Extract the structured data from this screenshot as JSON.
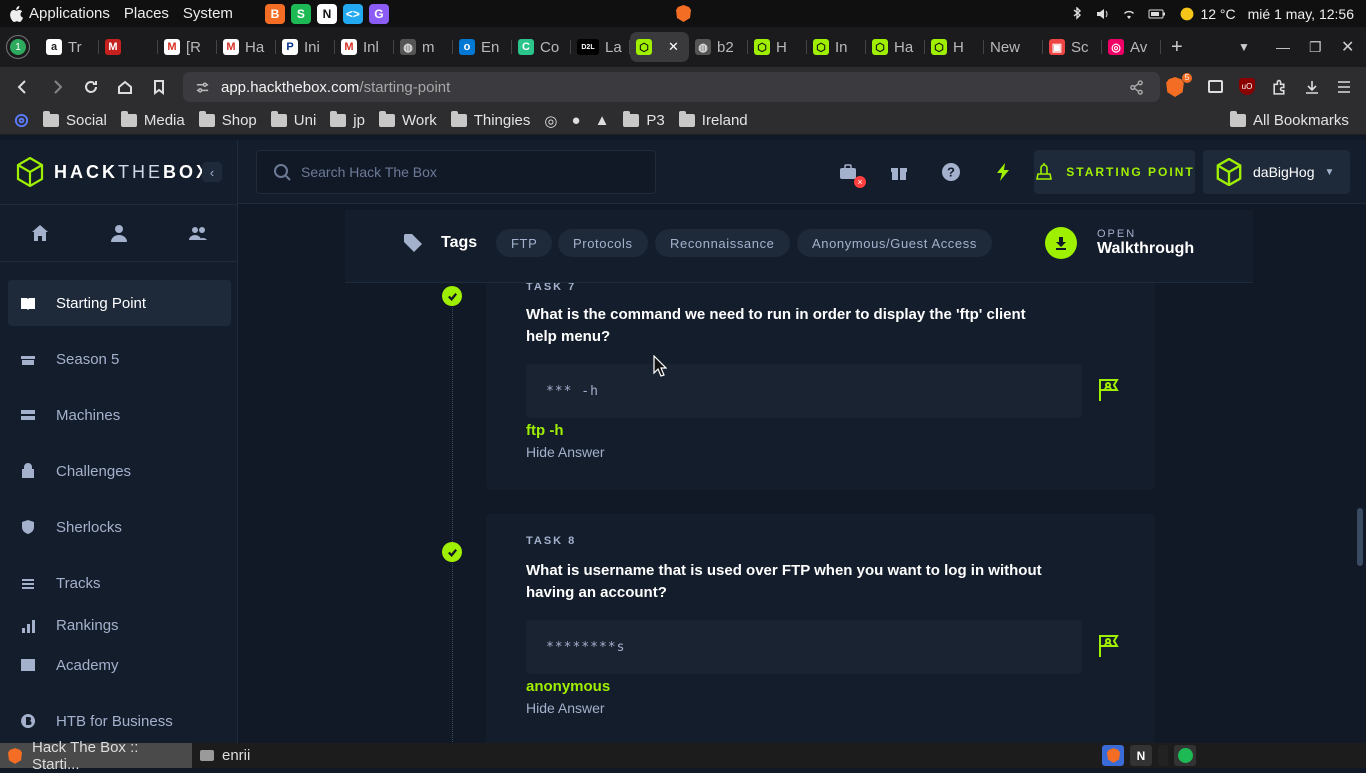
{
  "os": {
    "menu": [
      "Applications",
      "Places",
      "System"
    ],
    "tray": {
      "temperature": "12 °C",
      "datetime": "mié 1 may, 12:56"
    },
    "quick_launch": [
      {
        "icon": "brave-icon",
        "color": "#f36e24",
        "label": "B"
      },
      {
        "icon": "spotify-icon",
        "color": "#1db954",
        "label": "S"
      },
      {
        "icon": "notion-icon",
        "color": "#ffffff",
        "label": "N"
      },
      {
        "icon": "vscode-icon",
        "color": "#23a9f2",
        "label": "<>"
      },
      {
        "icon": "github-desktop-icon",
        "color": "#8b5cf6",
        "label": "G"
      }
    ]
  },
  "browser": {
    "tabs": [
      {
        "label": "Tr",
        "fav": "a",
        "color": "#ffffff",
        "text_color": "#222"
      },
      {
        "label": "",
        "fav": "M",
        "color": "#c5221f",
        "text_color": "#fff"
      },
      {
        "label": "[R",
        "fav": "M",
        "color": "#ffffff",
        "text_color": "#d93025"
      },
      {
        "label": "Ha",
        "fav": "M",
        "color": "#ffffff",
        "text_color": "#d93025"
      },
      {
        "label": "Ini",
        "fav": "P",
        "color": "#ffffff",
        "text_color": "#003087"
      },
      {
        "label": "Inl",
        "fav": "M",
        "color": "#ffffff",
        "text_color": "#d93025"
      },
      {
        "label": "m",
        "fav": "◍",
        "color": "#555",
        "text_color": "#ddd"
      },
      {
        "label": "En",
        "fav": "o",
        "color": "#0078d4",
        "text_color": "#fff"
      },
      {
        "label": "Co",
        "fav": "C",
        "color": "#2bc48a",
        "text_color": "#fff"
      },
      {
        "label": "La",
        "fav": "D2L",
        "color": "#000",
        "text_color": "#fff"
      },
      {
        "label": "",
        "fav": "⬡",
        "color": "#9fef00",
        "text_color": "#111",
        "active": true
      },
      {
        "label": "b2",
        "fav": "◍",
        "color": "#555",
        "text_color": "#ddd"
      },
      {
        "label": "H",
        "fav": "⬡",
        "color": "#9fef00",
        "text_color": "#111"
      },
      {
        "label": "In",
        "fav": "⬡",
        "color": "#9fef00",
        "text_color": "#111"
      },
      {
        "label": "Ha",
        "fav": "⬡",
        "color": "#9fef00",
        "text_color": "#111"
      },
      {
        "label": "H",
        "fav": "⬡",
        "color": "#9fef00",
        "text_color": "#111"
      },
      {
        "label": "New",
        "fav": "",
        "color": "transparent",
        "text_color": "#fff"
      },
      {
        "label": "Sc",
        "fav": "▣",
        "color": "#e44",
        "text_color": "#fff"
      },
      {
        "label": "Av",
        "fav": "◎",
        "color": "#e06",
        "text_color": "#fff"
      }
    ],
    "url_host": "app.hackthebox.com",
    "url_path": "/starting-point",
    "brave_badge": "5",
    "bookmarks": [
      "Social",
      "Media",
      "Shop",
      "Uni",
      "jp",
      "Work",
      "Thingies",
      "P3",
      "Ireland"
    ],
    "all_bookmarks": "All Bookmarks"
  },
  "htb": {
    "logo_text_1": "HACK",
    "logo_text_2": "THE",
    "logo_text_3": "BOX",
    "search_placeholder": "Search Hack The Box",
    "starting_point_button": "STARTING POINT",
    "username": "daBigHog",
    "nav": [
      "Starting Point",
      "Season 5",
      "Machines",
      "Challenges",
      "Sherlocks",
      "Tracks",
      "Rankings"
    ],
    "nav_bottom": [
      "Academy",
      "HTB for Business"
    ],
    "tags_label": "Tags",
    "tags": [
      "FTP",
      "Protocols",
      "Reconnaissance",
      "Anonymous/Guest Access"
    ],
    "walkthrough_small": "OPEN",
    "walkthrough_big": "Walkthrough",
    "tasks": [
      {
        "label": "TASK 7",
        "question": "What is the command we need to run in order to display the 'ftp' client help menu?",
        "masked": "*** -h",
        "answer": "ftp -h",
        "hide": "Hide Answer"
      },
      {
        "label": "TASK 8",
        "question": "What is username that is used over FTP when you want to log in without having an account?",
        "masked": "********s",
        "answer": "anonymous",
        "hide": "Hide Answer"
      }
    ]
  },
  "taskbar": {
    "active_window": "Hack The Box :: Starti...",
    "folder": "enrii"
  },
  "colors": {
    "accent": "#9fef00",
    "background": "#111927",
    "panel": "#141d2b"
  }
}
